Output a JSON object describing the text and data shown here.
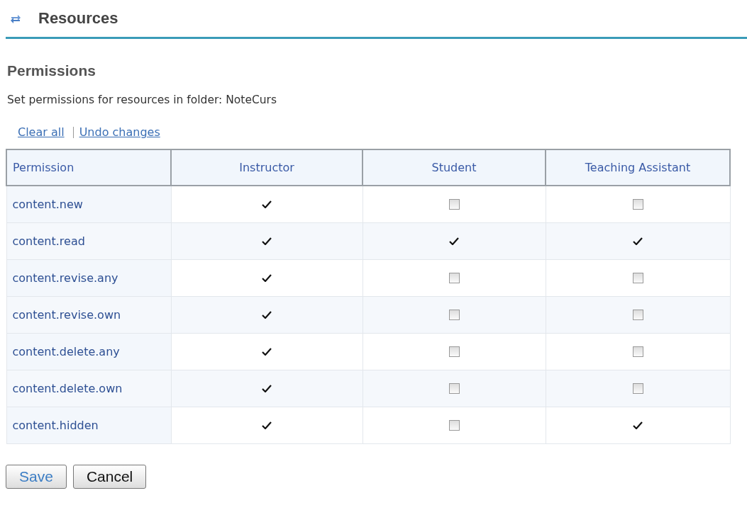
{
  "header": {
    "title": "Resources"
  },
  "heading": "Permissions",
  "description": "Set permissions for resources in folder: NoteCurs",
  "links": [
    "Clear all",
    "Undo changes"
  ],
  "table": {
    "columns": [
      "Permission",
      "Instructor",
      "Student",
      "Teaching Assistant"
    ],
    "rows": [
      {
        "permission": "content.new",
        "cells": [
          {
            "kind": "tick"
          },
          {
            "kind": "checkbox",
            "checked": false
          },
          {
            "kind": "checkbox",
            "checked": false
          }
        ]
      },
      {
        "permission": "content.read",
        "cells": [
          {
            "kind": "tick"
          },
          {
            "kind": "tick"
          },
          {
            "kind": "tick"
          }
        ]
      },
      {
        "permission": "content.revise.any",
        "cells": [
          {
            "kind": "tick"
          },
          {
            "kind": "checkbox",
            "checked": false
          },
          {
            "kind": "checkbox",
            "checked": false
          }
        ]
      },
      {
        "permission": "content.revise.own",
        "cells": [
          {
            "kind": "tick"
          },
          {
            "kind": "checkbox",
            "checked": false
          },
          {
            "kind": "checkbox",
            "checked": false
          }
        ]
      },
      {
        "permission": "content.delete.any",
        "cells": [
          {
            "kind": "tick"
          },
          {
            "kind": "checkbox",
            "checked": false
          },
          {
            "kind": "checkbox",
            "checked": false
          }
        ]
      },
      {
        "permission": "content.delete.own",
        "cells": [
          {
            "kind": "tick"
          },
          {
            "kind": "checkbox",
            "checked": false
          },
          {
            "kind": "checkbox",
            "checked": false
          }
        ]
      },
      {
        "permission": "content.hidden",
        "cells": [
          {
            "kind": "tick"
          },
          {
            "kind": "checkbox",
            "checked": false
          },
          {
            "kind": "tick"
          }
        ]
      }
    ]
  },
  "buttons": [
    {
      "label": "Save",
      "kind": "primary"
    },
    {
      "label": "Cancel",
      "kind": "secondary"
    }
  ]
}
